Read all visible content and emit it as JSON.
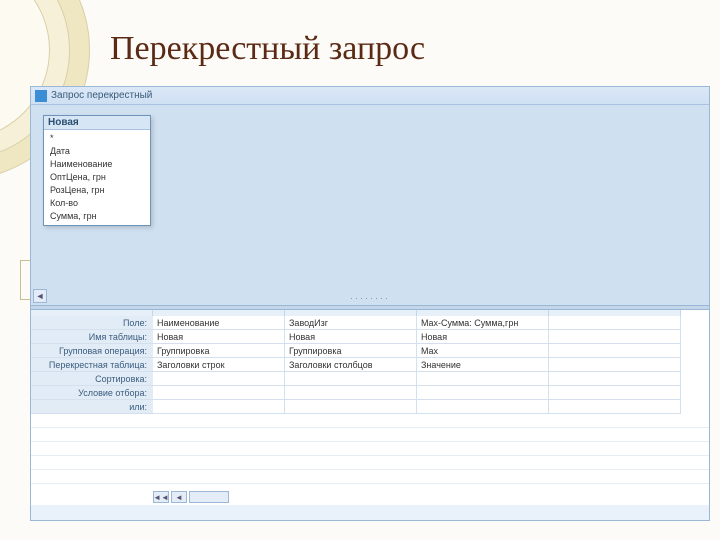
{
  "slide": {
    "title": "Перекрестный запрос"
  },
  "window": {
    "title": "Запрос перекрестный"
  },
  "table_box": {
    "title": "Новая",
    "fields": [
      "*",
      "Дата",
      "Наименование",
      "ОптЦена, грн",
      "РозЦена, грн",
      "Кол-во",
      "Сумма, грн"
    ]
  },
  "design": {
    "rows": [
      "Поле:",
      "Имя таблицы:",
      "Групповая операция:",
      "Перекрестная таблица:",
      "Сортировка:",
      "Условие отбора:",
      "или:"
    ],
    "columns": [
      {
        "field": "Наименование",
        "table": "Новая",
        "group": "Группировка",
        "crosstab": "Заголовки строк",
        "sort": "",
        "criteria": "",
        "or": ""
      },
      {
        "field": "ЗаводИзг",
        "table": "Новая",
        "group": "Группировка",
        "crosstab": "Заголовки столбцов",
        "sort": "",
        "criteria": "",
        "or": ""
      },
      {
        "field": "Max-Сумма: Сумма,грн",
        "table": "Новая",
        "group": "Max",
        "crosstab": "Значение",
        "sort": "",
        "criteria": "",
        "or": ""
      },
      {
        "field": "",
        "table": "",
        "group": "",
        "crosstab": "",
        "sort": "",
        "criteria": "",
        "or": ""
      }
    ]
  },
  "glyphs": {
    "left": "◄",
    "right": "►",
    "lleft": "◄◄"
  }
}
